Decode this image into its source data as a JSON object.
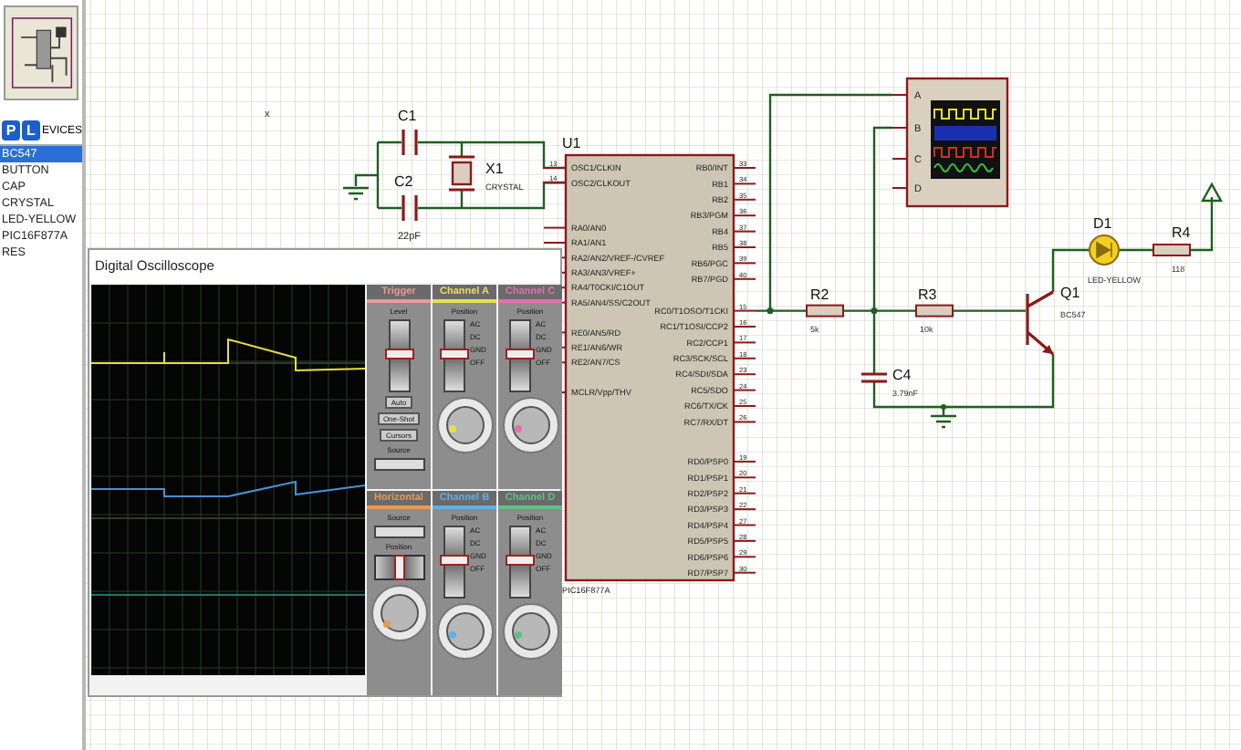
{
  "sidebar": {
    "mode_buttons": [
      "P",
      "L"
    ],
    "header": "EVICES",
    "devices": [
      {
        "label": "BC547",
        "selected": true
      },
      {
        "label": "BUTTON",
        "selected": false
      },
      {
        "label": "CAP",
        "selected": false
      },
      {
        "label": "CRYSTAL",
        "selected": false
      },
      {
        "label": "LED-YELLOW",
        "selected": false
      },
      {
        "label": "PIC16F877A",
        "selected": false
      },
      {
        "label": "RES",
        "selected": false
      }
    ]
  },
  "schematic": {
    "stray_mark": "x",
    "c1": {
      "ref": "C1"
    },
    "c2": {
      "ref": "C2",
      "value": "22pF"
    },
    "x1": {
      "ref": "X1",
      "value": "CRYSTAL"
    },
    "u1": {
      "ref": "U1",
      "value": "PIC16F877A",
      "left_pins": [
        {
          "name": "OSC1/CLKIN",
          "number": "13"
        },
        {
          "name": "OSC2/CLKOUT",
          "number": "14"
        },
        {
          "name": "RA0/AN0"
        },
        {
          "name": "RA1/AN1"
        },
        {
          "name": "RA2/AN2/VREF-/CVREF"
        },
        {
          "name": "RA3/AN3/VREF+"
        },
        {
          "name": "RA4/T0CKI/C1OUT"
        },
        {
          "name": "RA5/AN4/SS/C2OUT"
        },
        {
          "name": "RE0/AN5/RD"
        },
        {
          "name": "RE1/AN6/WR"
        },
        {
          "name": "RE2/AN7/CS"
        },
        {
          "name": "MCLR/Vpp/THV"
        }
      ],
      "right_pins": [
        {
          "name": "RB0/INT",
          "number": "33"
        },
        {
          "name": "RB1",
          "number": "34"
        },
        {
          "name": "RB2",
          "number": "35"
        },
        {
          "name": "RB3/PGM",
          "number": "36"
        },
        {
          "name": "RB4",
          "number": "37"
        },
        {
          "name": "RB5",
          "number": "38"
        },
        {
          "name": "RB6/PGC",
          "number": "39"
        },
        {
          "name": "RB7/PGD",
          "number": "40"
        },
        {
          "name": "RC0/T1OSO/T1CKI",
          "number": "15"
        },
        {
          "name": "RC1/T1OSI/CCP2",
          "number": "16"
        },
        {
          "name": "RC2/CCP1",
          "number": "17"
        },
        {
          "name": "RC3/SCK/SCL",
          "number": "18"
        },
        {
          "name": "RC4/SDI/SDA",
          "number": "23"
        },
        {
          "name": "RC5/SDO",
          "number": "24"
        },
        {
          "name": "RC6/TX/CK",
          "number": "25"
        },
        {
          "name": "RC7/RX/DT",
          "number": "26"
        },
        {
          "name": "RD0/PSP0",
          "number": "19"
        },
        {
          "name": "RD1/PSP1",
          "number": "20"
        },
        {
          "name": "RD2/PSP2",
          "number": "21"
        },
        {
          "name": "RD3/PSP3",
          "number": "22"
        },
        {
          "name": "RD4/PSP4",
          "number": "27"
        },
        {
          "name": "RD5/PSP5",
          "number": "28"
        },
        {
          "name": "RD6/PSP6",
          "number": "29"
        },
        {
          "name": "RD7/PSP7",
          "number": "30"
        }
      ]
    },
    "scope_symbol": {
      "inputs": [
        "A",
        "B",
        "C",
        "D"
      ]
    },
    "r2": {
      "ref": "R2",
      "value": "5k"
    },
    "r3": {
      "ref": "R3",
      "value": "10k"
    },
    "c4": {
      "ref": "C4",
      "value": "3.79nF"
    },
    "q1": {
      "ref": "Q1",
      "value": "BC547"
    },
    "d1": {
      "ref": "D1",
      "value": "LED-YELLOW"
    },
    "r4": {
      "ref": "R4",
      "value": "118"
    }
  },
  "oscilloscope": {
    "title": "Digital Oscilloscope",
    "panels": [
      {
        "kind": "trigger",
        "title": "Trigger",
        "color": "#e89a9a",
        "level_label": "Level",
        "level": 0.5,
        "buttons": [
          "Auto",
          "One-Shot",
          "Cursors"
        ],
        "source_label": "Source"
      },
      {
        "kind": "channel",
        "title": "Channel A",
        "color": "#e6e050",
        "position_label": "Position",
        "level": 0.5,
        "coupling": [
          "AC",
          "DC",
          "GND",
          "OFF"
        ]
      },
      {
        "kind": "channel",
        "title": "Channel C",
        "color": "#e070b0",
        "position_label": "Position",
        "level": 0.5,
        "coupling": [
          "AC",
          "DC",
          "GND",
          "OFF"
        ]
      },
      {
        "kind": "horizontal",
        "title": "Horizontal",
        "color": "#e89a50",
        "source_label": "Source",
        "position_label": "Position",
        "level": 0.5
      },
      {
        "kind": "channel",
        "title": "Channel B",
        "color": "#60b0e0",
        "position_label": "Position",
        "level": 0.5,
        "coupling": [
          "AC",
          "DC",
          "GND",
          "OFF"
        ]
      },
      {
        "kind": "channel",
        "title": "Channel D",
        "color": "#60c080",
        "position_label": "Position",
        "level": 0.5,
        "coupling": [
          "AC",
          "DC",
          "GND",
          "OFF"
        ]
      }
    ]
  }
}
